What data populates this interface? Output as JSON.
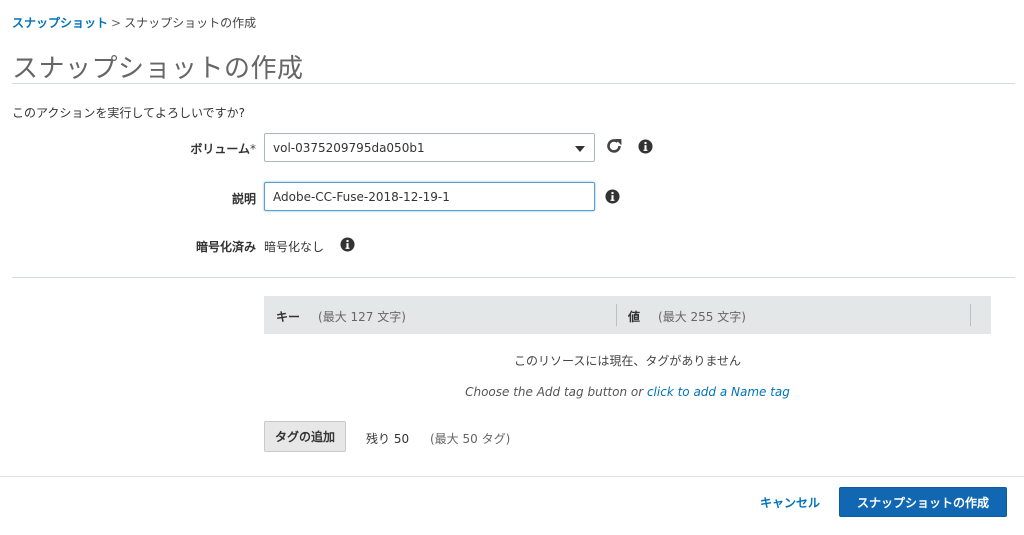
{
  "breadcrumb": {
    "parent": "スナップショット",
    "separator": ">",
    "current": "スナップショットの作成"
  },
  "page": {
    "title": "スナップショットの作成",
    "confirm": "このアクションを実行してよろしいですか?"
  },
  "form": {
    "volume": {
      "label": "ボリューム",
      "required_mark": "*",
      "value": "vol-0375209795da050b1",
      "refresh_icon": "refresh-icon",
      "info_icon": "info-icon"
    },
    "description": {
      "label": "説明",
      "value": "Adobe-CC-Fuse-2018-12-19-1",
      "info_icon": "info-icon"
    },
    "encryption": {
      "label": "暗号化済み",
      "value": "暗号化なし",
      "info_icon": "info-icon"
    }
  },
  "tags": {
    "key_header": "キー",
    "key_hint": "(最大 127 文字)",
    "value_header": "値",
    "value_hint": "(最大 255 文字)",
    "empty_message": "このリソースには現在、タグがありません",
    "hint_prefix": "Choose the Add tag button or ",
    "hint_link": "click to add a Name tag",
    "add_button": "タグの追加",
    "remaining": "残り 50",
    "max": "(最大 50 タグ)"
  },
  "actions": {
    "cancel": "キャンセル",
    "create": "スナップショットの作成"
  },
  "colors": {
    "link": "#0073bb",
    "primary_button": "#1167b1",
    "header_bg": "#e4e7e8"
  }
}
